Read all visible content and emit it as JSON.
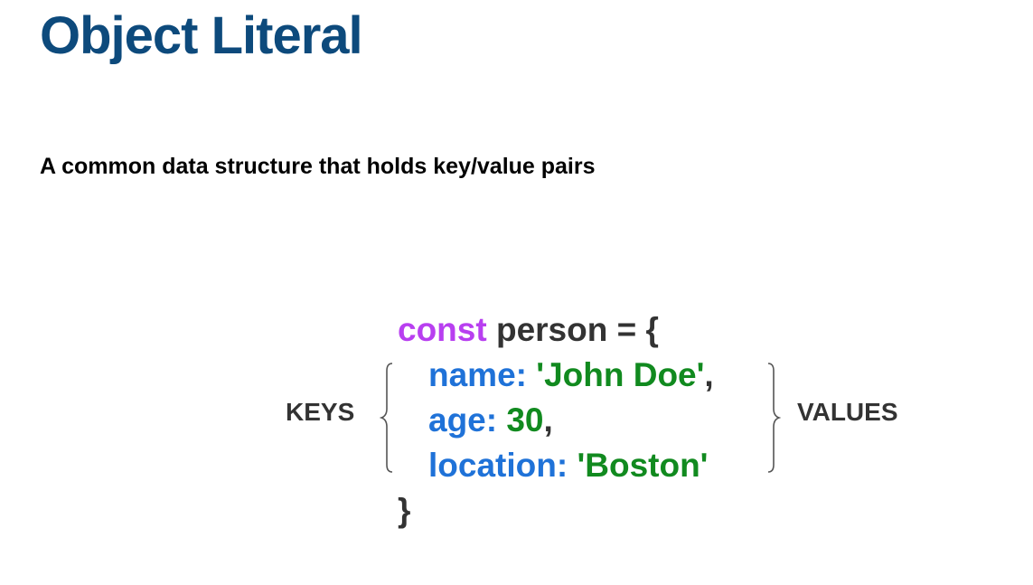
{
  "slide": {
    "title": "Object Literal",
    "subtitle": "A common data structure that holds key/value pairs"
  },
  "code": {
    "keyword": "const",
    "declaration": " person = {",
    "lines": [
      {
        "key": "name:",
        "value": "'John Doe'",
        "suffix": ","
      },
      {
        "key": "age:",
        "value": "30",
        "suffix": ","
      },
      {
        "key": "location:",
        "value": "'Boston'",
        "suffix": ""
      }
    ],
    "closing": "}"
  },
  "labels": {
    "keys": "KEYS",
    "values": "VALUES"
  },
  "colors": {
    "title": "#0d4a7c",
    "keyword": "#b83ff0",
    "key": "#1f72d8",
    "value": "#118a1f",
    "text": "#333333"
  }
}
